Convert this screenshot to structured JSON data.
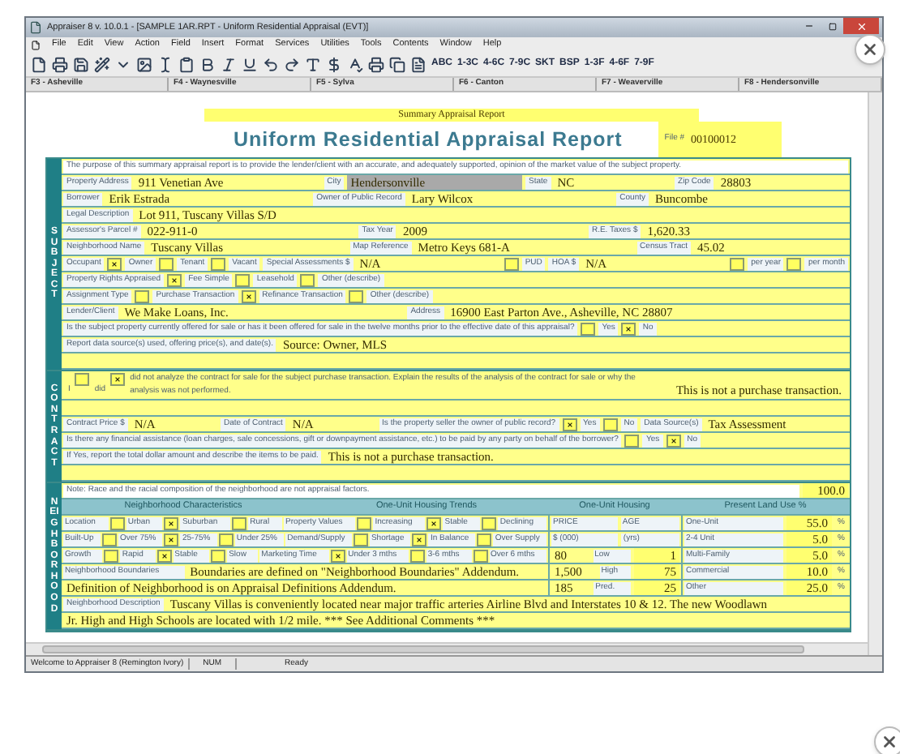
{
  "window": {
    "title": "Appraiser 8 v. 10.0.1 - [SAMPLE 1AR.RPT - Uniform Residential Appraisal (EVT)]"
  },
  "menu": [
    "File",
    "Edit",
    "View",
    "Action",
    "Field",
    "Insert",
    "Format",
    "Services",
    "Utilities",
    "Tools",
    "Contents",
    "Window",
    "Help"
  ],
  "toolbar_buttons": [
    "ABC",
    "1-3C",
    "4-6C",
    "7-9C",
    "SKT",
    "BSP",
    "1-3F",
    "4-6F",
    "7-9F"
  ],
  "tabs": [
    "F3 - Asheville",
    "F4 - Waynesville",
    "F5 - Sylva",
    "F6 - Canton",
    "F7 - Weaverville",
    "F8 - Hendersonville"
  ],
  "banner": "Summary Appraisal Report",
  "form_title": "Uniform Residential Appraisal Report",
  "file_number": {
    "label": "File #",
    "value": "00100012"
  },
  "sections": [
    {
      "title": "SUBJECT",
      "rows": [
        {
          "kind": "cells",
          "cells": [
            {
              "kind": "note",
              "text": "The purpose of this summary appraisal report is to provide the lender/client with an accurate, and adequately supported, opinion of the market value of the subject property."
            }
          ]
        },
        {
          "kind": "cells",
          "cells": [
            {
              "kind": "label",
              "text": "Property Address"
            },
            {
              "kind": "value",
              "text": "911 Venetian Ave"
            },
            {
              "kind": "label",
              "text": "City"
            },
            {
              "kind": "focused",
              "text": "Hendersonville"
            },
            {
              "kind": "label",
              "text": "State"
            },
            {
              "kind": "value",
              "text": "NC"
            },
            {
              "kind": "label",
              "text": "Zip Code"
            },
            {
              "kind": "value",
              "text": "28803"
            }
          ]
        },
        {
          "kind": "cells",
          "cells": [
            {
              "kind": "label",
              "text": "Borrower"
            },
            {
              "kind": "value",
              "text": "Erik Estrada"
            },
            {
              "kind": "label",
              "text": "Owner of Public Record"
            },
            {
              "kind": "value",
              "text": "Lary Wilcox"
            },
            {
              "kind": "label",
              "text": "County"
            },
            {
              "kind": "value",
              "text": "Buncombe"
            }
          ]
        },
        {
          "kind": "cells",
          "cells": [
            {
              "kind": "label",
              "text": "Legal Description"
            },
            {
              "kind": "value",
              "text": "Lot 911, Tuscany Villas S/D"
            }
          ]
        },
        {
          "kind": "cells",
          "cells": [
            {
              "kind": "label",
              "text": "Assessor's Parcel #"
            },
            {
              "kind": "value",
              "text": "022-911-0"
            },
            {
              "kind": "label",
              "text": "Tax Year"
            },
            {
              "kind": "value",
              "text": "2009"
            },
            {
              "kind": "label",
              "text": "R.E. Taxes $"
            },
            {
              "kind": "value",
              "text": "1,620.33"
            }
          ]
        },
        {
          "kind": "cells",
          "cells": [
            {
              "kind": "label",
              "text": "Neighborhood Name"
            },
            {
              "kind": "value",
              "text": "Tuscany Villas"
            },
            {
              "kind": "label",
              "text": "Map Reference"
            },
            {
              "kind": "value",
              "text": "Metro Keys 681-A"
            },
            {
              "kind": "label",
              "text": "Census Tract"
            },
            {
              "kind": "value",
              "text": "45.02"
            }
          ]
        },
        {
          "kind": "cells",
          "cells": [
            {
              "kind": "label",
              "text": "Occupant"
            },
            {
              "kind": "check",
              "checked": true
            },
            {
              "kind": "label",
              "text": "Owner"
            },
            {
              "kind": "check",
              "checked": false
            },
            {
              "kind": "label",
              "text": "Tenant"
            },
            {
              "kind": "check",
              "checked": false
            },
            {
              "kind": "label",
              "text": "Vacant"
            },
            {
              "kind": "label",
              "text": "Special Assessments $"
            },
            {
              "kind": "value",
              "text": "N/A"
            },
            {
              "kind": "check",
              "checked": false
            },
            {
              "kind": "label",
              "text": "PUD"
            },
            {
              "kind": "label",
              "text": "HOA $"
            },
            {
              "kind": "value",
              "text": "N/A"
            },
            {
              "kind": "check",
              "checked": false
            },
            {
              "kind": "label",
              "text": "per year"
            },
            {
              "kind": "check",
              "checked": false
            },
            {
              "kind": "label",
              "text": "per month"
            }
          ]
        },
        {
          "kind": "cells",
          "cells": [
            {
              "kind": "label",
              "text": "Property Rights Appraised"
            },
            {
              "kind": "check",
              "checked": true
            },
            {
              "kind": "label",
              "text": "Fee Simple"
            },
            {
              "kind": "check",
              "checked": false
            },
            {
              "kind": "label",
              "text": "Leasehold"
            },
            {
              "kind": "check",
              "checked": false
            },
            {
              "kind": "label",
              "text": "Other (describe)"
            }
          ]
        },
        {
          "kind": "cells",
          "cells": [
            {
              "kind": "label",
              "text": "Assignment Type"
            },
            {
              "kind": "check",
              "checked": false
            },
            {
              "kind": "label",
              "text": "Purchase Transaction"
            },
            {
              "kind": "check",
              "checked": true
            },
            {
              "kind": "label",
              "text": "Refinance Transaction"
            },
            {
              "kind": "check",
              "checked": false
            },
            {
              "kind": "label",
              "text": "Other (describe)"
            }
          ]
        },
        {
          "kind": "cells",
          "cells": [
            {
              "kind": "label",
              "text": "Lender/Client"
            },
            {
              "kind": "value",
              "text": "We Make Loans, Inc."
            },
            {
              "kind": "label",
              "text": "Address"
            },
            {
              "kind": "value",
              "text": "16900 East Parton Ave., Asheville, NC 28807"
            }
          ]
        },
        {
          "kind": "cells",
          "cells": [
            {
              "kind": "label",
              "text": "Is the subject property currently offered for sale or has it been offered for sale in the twelve months prior to the effective date of this appraisal?"
            },
            {
              "kind": "check",
              "checked": false
            },
            {
              "kind": "label",
              "text": "Yes"
            },
            {
              "kind": "check",
              "checked": true
            },
            {
              "kind": "label",
              "text": "No"
            }
          ]
        },
        {
          "kind": "cells",
          "cells": [
            {
              "kind": "label",
              "text": "Report data source(s) used, offering price(s), and date(s)."
            },
            {
              "kind": "value",
              "text": "Source: Owner, MLS"
            }
          ]
        },
        {
          "kind": "blank"
        }
      ]
    },
    {
      "title": "CONTRACT",
      "rows": [
        {
          "kind": "flow",
          "cells": [
            {
              "kind": "label",
              "text": "I"
            },
            {
              "kind": "check",
              "checked": false
            },
            {
              "kind": "label",
              "text": "did"
            },
            {
              "kind": "check",
              "checked": true
            },
            {
              "kind": "label",
              "text": "did not analyze the contract for sale for the subject purchase transaction. Explain the results of the analysis of the contract for sale or why the analysis was not performed."
            },
            {
              "kind": "value",
              "text": "This is not a purchase transaction."
            }
          ]
        },
        {
          "kind": "blank"
        },
        {
          "kind": "cells",
          "cells": [
            {
              "kind": "label",
              "text": "Contract Price $"
            },
            {
              "kind": "value",
              "text": "N/A"
            },
            {
              "kind": "label",
              "text": "Date of Contract"
            },
            {
              "kind": "value",
              "text": "N/A"
            },
            {
              "kind": "label",
              "text": "Is the property seller the owner of public record?"
            },
            {
              "kind": "check",
              "checked": true
            },
            {
              "kind": "label",
              "text": "Yes"
            },
            {
              "kind": "check",
              "checked": false
            },
            {
              "kind": "label",
              "text": "No"
            },
            {
              "kind": "label",
              "text": "Data Source(s)"
            },
            {
              "kind": "value",
              "text": "Tax Assessment"
            }
          ]
        },
        {
          "kind": "cells",
          "cells": [
            {
              "kind": "label",
              "text": "Is there any financial assistance (loan charges, sale concessions, gift or downpayment assistance, etc.) to be paid by any party on behalf of the borrower?"
            },
            {
              "kind": "check",
              "checked": false
            },
            {
              "kind": "label",
              "text": "Yes"
            },
            {
              "kind": "check",
              "checked": true
            },
            {
              "kind": "label",
              "text": "No"
            }
          ]
        },
        {
          "kind": "cells",
          "cells": [
            {
              "kind": "label",
              "text": "If Yes, report the total dollar amount and describe the items to be paid."
            },
            {
              "kind": "value",
              "text": "This is not a purchase transaction."
            }
          ]
        },
        {
          "kind": "blank"
        }
      ]
    },
    {
      "title": "NEIGHBORHOOD",
      "rows": [
        {
          "kind": "cells",
          "cells": [
            {
              "kind": "note",
              "text": "Note: Race and the racial composition of the neighborhood are not appraisal factors."
            },
            {
              "kind": "amount",
              "text": "100.0"
            }
          ]
        },
        {
          "kind": "grid",
          "headers": [
            "Neighborhood Characteristics",
            "One-Unit Housing Trends",
            "One-Unit Housing",
            "Present Land Use %"
          ],
          "lines": [
            {
              "left": [
                {
                  "kind": "label",
                  "text": "Location"
                },
                {
                  "kind": "check",
                  "checked": false
                },
                {
                  "kind": "label",
                  "text": "Urban"
                },
                {
                  "kind": "check",
                  "checked": true
                },
                {
                  "kind": "label",
                  "text": "Suburban"
                },
                {
                  "kind": "check",
                  "checked": false
                },
                {
                  "kind": "label",
                  "text": "Rural"
                },
                {
                  "kind": "label",
                  "text": "Property Values"
                },
                {
                  "kind": "check",
                  "checked": false
                },
                {
                  "kind": "label",
                  "text": "Increasing"
                },
                {
                  "kind": "check",
                  "checked": true
                },
                {
                  "kind": "label",
                  "text": "Stable"
                },
                {
                  "kind": "check",
                  "checked": false
                },
                {
                  "kind": "label",
                  "text": "Declining"
                }
              ],
              "housing": [
                {
                  "kind": "label",
                  "text": "PRICE"
                },
                {
                  "kind": "label",
                  "text": "AGE"
                }
              ],
              "land_use": [
                {
                  "kind": "label",
                  "text": "One-Unit"
                },
                {
                  "kind": "amount",
                  "text": "55.0"
                },
                {
                  "kind": "unit",
                  "text": "%"
                }
              ]
            },
            {
              "left": [
                {
                  "kind": "label",
                  "text": "Built-Up"
                },
                {
                  "kind": "check",
                  "checked": false
                },
                {
                  "kind": "label",
                  "text": "Over 75%"
                },
                {
                  "kind": "check",
                  "checked": true
                },
                {
                  "kind": "label",
                  "text": "25-75%"
                },
                {
                  "kind": "check",
                  "checked": false
                },
                {
                  "kind": "label",
                  "text": "Under 25%"
                },
                {
                  "kind": "label",
                  "text": "Demand/Supply"
                },
                {
                  "kind": "check",
                  "checked": false
                },
                {
                  "kind": "label",
                  "text": "Shortage"
                },
                {
                  "kind": "check",
                  "checked": true
                },
                {
                  "kind": "label",
                  "text": "In Balance"
                },
                {
                  "kind": "check",
                  "checked": false
                },
                {
                  "kind": "label",
                  "text": "Over Supply"
                }
              ],
              "housing": [
                {
                  "kind": "label",
                  "text": "$ (000)"
                },
                {
                  "kind": "label",
                  "text": "(yrs)"
                }
              ],
              "land_use": [
                {
                  "kind": "label",
                  "text": "2-4 Unit"
                },
                {
                  "kind": "amount",
                  "text": "5.0"
                },
                {
                  "kind": "unit",
                  "text": "%"
                }
              ]
            },
            {
              "left": [
                {
                  "kind": "label",
                  "text": "Growth"
                },
                {
                  "kind": "check",
                  "checked": false
                },
                {
                  "kind": "label",
                  "text": "Rapid"
                },
                {
                  "kind": "check",
                  "checked": true
                },
                {
                  "kind": "label",
                  "text": "Stable"
                },
                {
                  "kind": "check",
                  "checked": false
                },
                {
                  "kind": "label",
                  "text": "Slow"
                },
                {
                  "kind": "label",
                  "text": "Marketing Time"
                },
                {
                  "kind": "check",
                  "checked": true
                },
                {
                  "kind": "label",
                  "text": "Under 3 mths"
                },
                {
                  "kind": "check",
                  "checked": false
                },
                {
                  "kind": "label",
                  "text": "3-6 mths"
                },
                {
                  "kind": "check",
                  "checked": false
                },
                {
                  "kind": "label",
                  "text": "Over 6 mths"
                }
              ],
              "housing": [
                {
                  "kind": "value",
                  "text": "80"
                },
                {
                  "kind": "label",
                  "text": "Low"
                },
                {
                  "kind": "amount",
                  "text": "1"
                }
              ],
              "land_use": [
                {
                  "kind": "label",
                  "text": "Multi-Family"
                },
                {
                  "kind": "amount",
                  "text": "5.0"
                },
                {
                  "kind": "unit",
                  "text": "%"
                }
              ]
            },
            {
              "left": [
                {
                  "kind": "label",
                  "text": "Neighborhood Boundaries"
                },
                {
                  "kind": "value",
                  "text": "Boundaries are defined on \"Neighborhood Boundaries\" Addendum."
                }
              ],
              "housing": [
                {
                  "kind": "value",
                  "text": "1,500"
                },
                {
                  "kind": "label",
                  "text": "High"
                },
                {
                  "kind": "amount",
                  "text": "75"
                }
              ],
              "land_use": [
                {
                  "kind": "label",
                  "text": "Commercial"
                },
                {
                  "kind": "amount",
                  "text": "10.0"
                },
                {
                  "kind": "unit",
                  "text": "%"
                }
              ]
            },
            {
              "left": [
                {
                  "kind": "value",
                  "text": "Definition of Neighborhood is on Appraisal Definitions Addendum."
                }
              ],
              "housing": [
                {
                  "kind": "value",
                  "text": "185"
                },
                {
                  "kind": "label",
                  "text": "Pred."
                },
                {
                  "kind": "amount",
                  "text": "25"
                }
              ],
              "land_use": [
                {
                  "kind": "label",
                  "text": "Other"
                },
                {
                  "kind": "amount",
                  "text": "25.0"
                },
                {
                  "kind": "unit",
                  "text": "%"
                }
              ]
            }
          ]
        },
        {
          "kind": "cells",
          "cells": [
            {
              "kind": "label",
              "text": "Neighborhood Description"
            },
            {
              "kind": "value",
              "text": "Tuscany Villas is conveniently located near major traffic arteries Airline Blvd and Interstates 10 & 12. The new Woodlawn"
            }
          ]
        },
        {
          "kind": "cells",
          "cells": [
            {
              "kind": "value",
              "text": "Jr. High and High Schools are located with 1/2 mile.  *** See Additional Comments ***"
            }
          ]
        }
      ]
    }
  ],
  "status_bar": [
    "Welcome to Appraiser 8 (Remington Ivory)",
    "NUM",
    "Ready"
  ]
}
